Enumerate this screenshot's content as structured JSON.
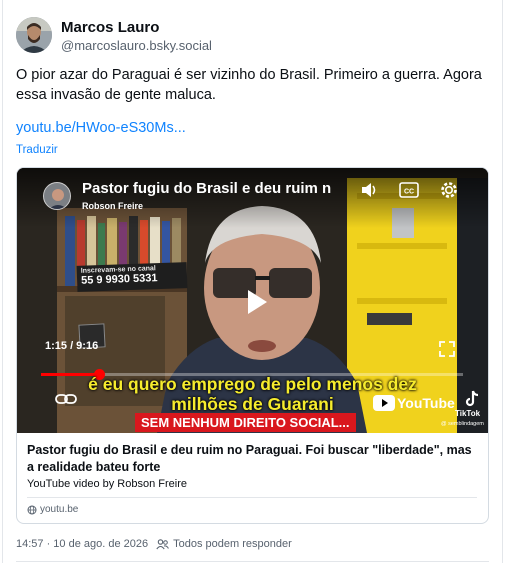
{
  "author": {
    "display_name": "Marcos Lauro",
    "handle": "@marcoslauro.bsky.social"
  },
  "post": {
    "text": "O pior azar do Paraguai é ser vizinho do Brasil. Primeiro a guerra. Agora essa invasão de gente maluca.",
    "link_text": "youtu.be/HWoo-eS30Ms...",
    "translate_label": "Traduzir",
    "timestamp": "14:57 · 10 de ago. de 2026",
    "reply_setting": "Todos podem responder"
  },
  "video": {
    "title": "Pastor fugiu do Brasil e deu ruim n",
    "channel": "Robson Freire",
    "time_display": "1:15 / 9:16",
    "progress_fraction": 0.137,
    "caption_line1": "é eu quero emprego de pelo menos dez",
    "caption_line2": "milhões de Guarani",
    "banner_text": "SEM NENHUM DIREITO SOCIAL...",
    "bg_sign_line1": "Inscrevam-se no canal",
    "bg_sign_line2": "55 9 9930 5331",
    "youtube_label": "YouTube",
    "tiktok_label": "TikTok",
    "tiktok_handle": "@ semblindagem"
  },
  "card": {
    "title": "Pastor fugiu do Brasil e deu ruim no Paraguai. Foi buscar \"liberdade\", mas a realidade bateu forte",
    "description": "YouTube video by Robson Freire",
    "domain": "youtu.be"
  },
  "colors": {
    "link": "#1083fe",
    "muted": "#58626e",
    "progress": "#ff0000",
    "caption": "#f6ec2d",
    "banner": "#d9171d"
  }
}
